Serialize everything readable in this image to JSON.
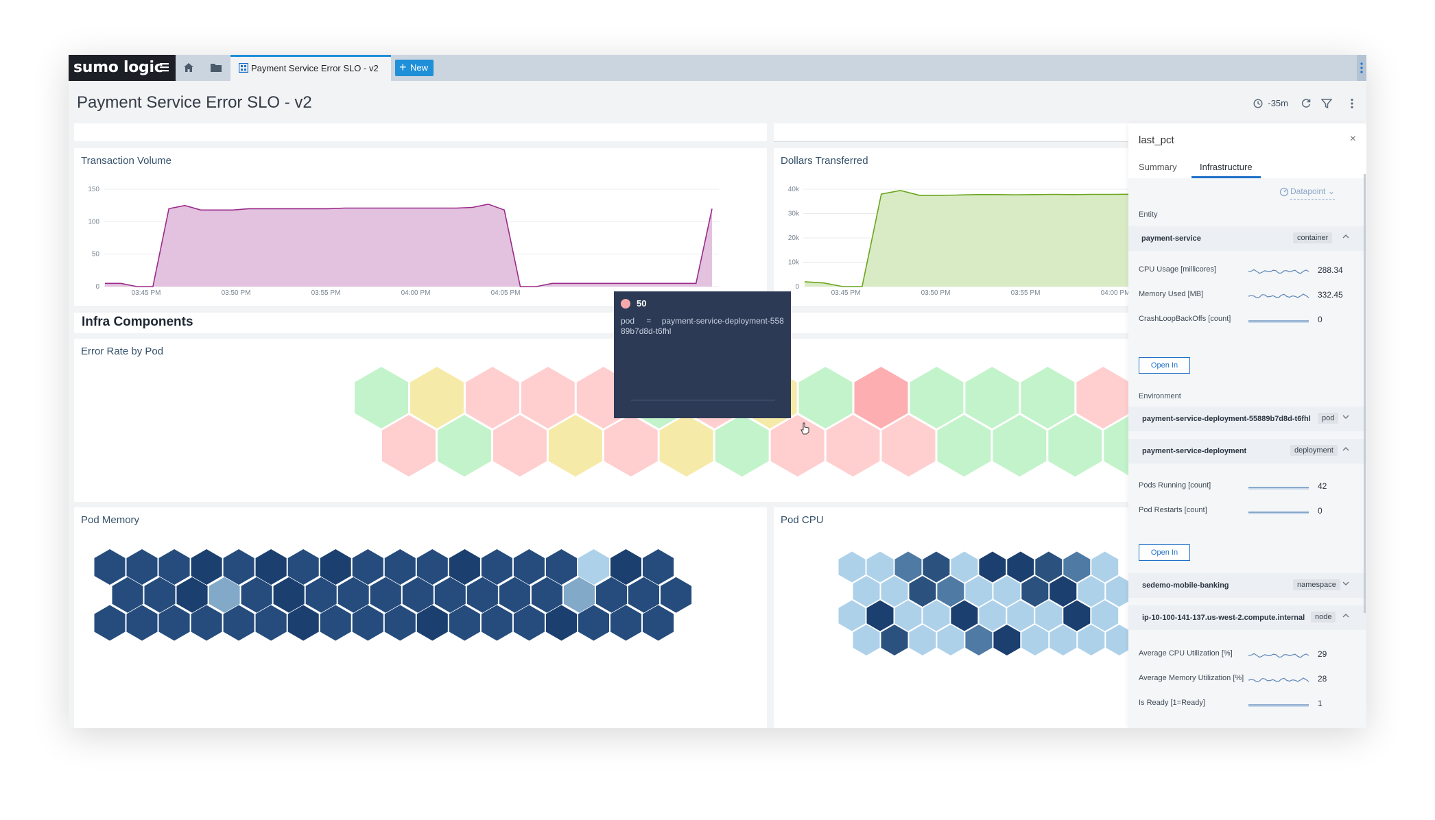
{
  "app": {
    "logo_text": "sumo logic"
  },
  "tabs": [
    {
      "label": "Payment Service Error SLO - v2"
    }
  ],
  "new_button": "New",
  "dashboard": {
    "title": "Payment Service Error SLO - v2",
    "time_range": "-35m"
  },
  "panels": {
    "transaction_volume": {
      "title": "Transaction Volume"
    },
    "dollars_transferred": {
      "title": "Dollars Transferred"
    },
    "section_title": "Infra Components",
    "error_rate": {
      "title": "Error Rate by Pod"
    },
    "pod_memory": {
      "title": "Pod Memory"
    },
    "pod_cpu": {
      "title": "Pod CPU"
    }
  },
  "chart_data": [
    {
      "type": "area",
      "title": "Transaction Volume",
      "ylim": [
        0,
        150
      ],
      "yticks": [
        "150",
        "100",
        "50",
        "0"
      ],
      "xticks": [
        "03:45 PM",
        "03:50 PM",
        "03:55 PM",
        "04:00 PM",
        "04:05 PM"
      ],
      "color": "#9b2a8a",
      "fill": "#e2c2de",
      "series": [
        {
          "values": [
            5,
            5,
            0,
            0,
            120,
            125,
            118,
            118,
            118,
            120,
            120,
            120,
            120,
            120,
            120,
            121,
            121,
            121,
            121,
            121,
            121,
            121,
            121,
            122,
            127,
            118,
            0,
            0,
            5,
            5,
            5,
            5,
            5,
            5,
            5,
            5,
            5,
            5,
            120
          ]
        }
      ]
    },
    {
      "type": "area",
      "title": "Dollars Transferred",
      "ylim": [
        0,
        40000
      ],
      "yticks": [
        "40k",
        "30k",
        "20k",
        "10k",
        "0"
      ],
      "xticks": [
        "03:45 PM",
        "03:50 PM",
        "03:55 PM",
        "04:00 PM"
      ],
      "color": "#6aa51d",
      "fill": "#d9ebc4",
      "series": [
        {
          "values": [
            2000,
            1500,
            0,
            0,
            38000,
            39500,
            37500,
            37500,
            37600,
            37800,
            37800,
            37700,
            37800,
            37900,
            37800,
            37900,
            37900,
            37950
          ]
        }
      ]
    }
  ],
  "hex_rows": {
    "error_rate": [
      {
        "colors": [
          "#c3f3ca",
          "#f6eaa8",
          "#ffcfd0",
          "#ffcfd0",
          "#ffcfd0",
          "#c3f3ca",
          "#ffcfd0",
          "#f6eaa8",
          "#c3f3ca",
          "#fcaeb0",
          "#c3f3ca",
          "#c3f3ca",
          "#c3f3ca",
          "#ffcfd0",
          "#ffcfd0"
        ]
      },
      {
        "colors": [
          "#ffcfd0",
          "#c3f3ca",
          "#ffcfd0",
          "#f6eaa8",
          "#ffcfd0",
          "#f6eaa8",
          "#c3f3ca",
          "#ffcfd0",
          "#ffcfd0",
          "#ffcfd0",
          "#c3f3ca",
          "#c3f3ca",
          "#c3f3ca",
          "#c3f3ca",
          "#f6eaa8"
        ]
      }
    ],
    "pod_memory": [
      {
        "colors": [
          "#254c7c",
          "#254c7c",
          "#254c7c",
          "#1b3f6e",
          "#254c7c",
          "#1b3f6e",
          "#254c7c",
          "#1b3f6e",
          "#254c7c",
          "#254c7c",
          "#254c7c",
          "#1b3f6e",
          "#254c7c",
          "#254c7c",
          "#254c7c",
          "#aed1ea",
          "#1b3f6e",
          "#254c7c"
        ]
      },
      {
        "colors": [
          "#254c7c",
          "#254c7c",
          "#1b3f6e",
          "#82a9c8",
          "#254c7c",
          "#1b3f6e",
          "#254c7c",
          "#254c7c",
          "#254c7c",
          "#254c7c",
          "#254c7c",
          "#254c7c",
          "#254c7c",
          "#254c7c",
          "#82a9c8",
          "#254c7c",
          "#254c7c",
          "#254c7c"
        ]
      },
      {
        "colors": [
          "#254c7c",
          "#254c7c",
          "#254c7c",
          "#254c7c",
          "#254c7c",
          "#254c7c",
          "#1b3f6e",
          "#254c7c",
          "#254c7c",
          "#254c7c",
          "#1b3f6e",
          "#254c7c",
          "#254c7c",
          "#254c7c",
          "#1b3f6e",
          "#254c7c",
          "#254c7c",
          "#254c7c"
        ]
      }
    ],
    "pod_cpu": [
      {
        "colors": [
          "#aed1ea",
          "#aed1ea",
          "#4f7aa4",
          "#2b527f",
          "#aed1ea",
          "#1b3f6e",
          "#1b3f6e",
          "#2b527f",
          "#4f7aa4",
          "#aed1ea"
        ]
      },
      {
        "colors": [
          "#aed1ea",
          "#aed1ea",
          "#2b527f",
          "#4f7aa4",
          "#aed1ea",
          "#aed1ea",
          "#2b527f",
          "#1b3f6e",
          "#aed1ea",
          "#aed1ea"
        ]
      },
      {
        "colors": [
          "#aed1ea",
          "#1b3f6e",
          "#aed1ea",
          "#aed1ea",
          "#1b3f6e",
          "#aed1ea",
          "#aed1ea",
          "#aed1ea",
          "#1b3f6e",
          "#aed1ea"
        ]
      },
      {
        "colors": [
          "#aed1ea",
          "#2b527f",
          "#aed1ea",
          "#aed1ea",
          "#4f7aa4",
          "#1b3f6e",
          "#aed1ea",
          "#aed1ea",
          "#aed1ea",
          "#aed1ea"
        ]
      }
    ]
  },
  "tooltip": {
    "value": "50",
    "key": "pod",
    "op": "=",
    "val": "payment-service-deployment-55889b7d8d-t6fhl"
  },
  "side_panel": {
    "title": "last_pct",
    "tabs": [
      "Summary",
      "Infrastructure"
    ],
    "datapoint_label": "Datapoint",
    "entity_label": "Entity",
    "environment_label": "Environment",
    "open_in_label": "Open In",
    "entity": {
      "name": "payment-service",
      "tag": "container"
    },
    "entity_metrics": [
      {
        "label": "CPU Usage [millicores]",
        "value": "288.34"
      },
      {
        "label": "Memory Used [MB]",
        "value": "332.45"
      },
      {
        "label": "CrashLoopBackOffs [count]",
        "value": "0"
      }
    ],
    "env_pod": {
      "name": "payment-service-deployment-55889b7d8d-t6fhl",
      "tag": "pod"
    },
    "env_deployment": {
      "name": "payment-service-deployment",
      "tag": "deployment"
    },
    "deployment_metrics": [
      {
        "label": "Pods Running [count]",
        "value": "42"
      },
      {
        "label": "Pod Restarts [count]",
        "value": "0"
      }
    ],
    "env_namespace": {
      "name": "sedemo-mobile-banking",
      "tag": "namespace"
    },
    "env_node": {
      "name": "ip-10-100-141-137.us-west-2.compute.internal",
      "tag": "node"
    },
    "node_metrics": [
      {
        "label": "Average CPU Utilization [%]",
        "value": "29"
      },
      {
        "label": "Average Memory Utilization [%]",
        "value": "28"
      },
      {
        "label": "Is Ready [1=Ready]",
        "value": "1"
      }
    ]
  }
}
